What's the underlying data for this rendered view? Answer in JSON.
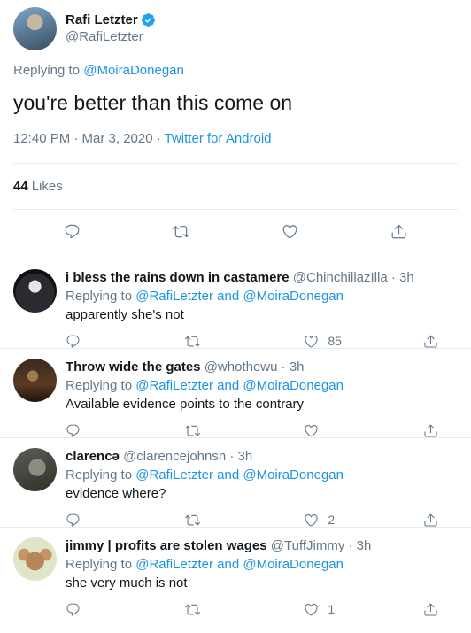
{
  "main_tweet": {
    "display_name": "Rafi Letzter",
    "handle": "@RafiLetzter",
    "replying_prefix": "Replying to",
    "replying_to": "@MoiraDonegan",
    "text": "you're better than this come on",
    "timestamp": "12:40 PM · Mar 3, 2020 · ",
    "source": "Twitter for Android",
    "likes_count": "44",
    "likes_label": "Likes"
  },
  "replies": [
    {
      "display_name": "i bless the rains down in castamere",
      "handle": "@ChinchillazIlla",
      "time": " · 3h",
      "replying_prefix": "Replying to",
      "replying_to_1": "@RafiLetzter",
      "and": "and",
      "replying_to_2": "@MoiraDonegan",
      "text": "apparently she's not",
      "like_count": "85"
    },
    {
      "display_name": "Throw wide the gates",
      "handle": "@whothewu",
      "time": " · 3h",
      "replying_prefix": "Replying to",
      "replying_to_1": "@RafiLetzter",
      "and": "and",
      "replying_to_2": "@MoiraDonegan",
      "text": "Available evidence points to the contrary",
      "like_count": ""
    },
    {
      "display_name": "clarencə",
      "handle": "@clarencejohnsn",
      "time": " · 3h",
      "replying_prefix": "Replying to",
      "replying_to_1": "@RafiLetzter",
      "and": "and",
      "replying_to_2": "@MoiraDonegan",
      "text": "evidence where?",
      "like_count": "2"
    },
    {
      "display_name": "jimmy | profits are stolen wages",
      "handle": "@TuffJimmy",
      "time": " · 3h",
      "replying_prefix": "Replying to",
      "replying_to_1": "@RafiLetzter",
      "and": "and",
      "replying_to_2": "@MoiraDonegan",
      "text": "she very much is not",
      "like_count": "1"
    }
  ],
  "colors": {
    "link": "#1b95e0",
    "secondary": "#657786",
    "verified": "#1da1f2"
  },
  "icons": [
    "reply-icon",
    "retweet-icon",
    "like-icon",
    "share-icon",
    "verified-badge-icon"
  ]
}
